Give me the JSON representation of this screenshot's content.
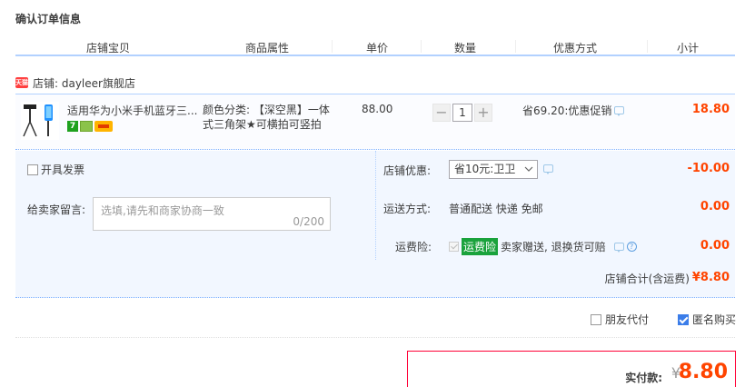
{
  "page_title": "确认订单信息",
  "columns": [
    "店铺宝贝",
    "商品属性",
    "单价",
    "数量",
    "优惠方式",
    "小计"
  ],
  "shop": {
    "badge_text": "天猫",
    "label": "店铺: dayleer旗舰店"
  },
  "item": {
    "title": "适用华为小米手机蓝牙三...",
    "badge_7": "7",
    "attributes": "颜色分类: 【深空黑】一体式三角架★可横拍可竖拍",
    "price": "88.00",
    "quantity": "1",
    "minus_label": "−",
    "plus_label": "+",
    "promo": "省69.20:优惠促销",
    "subtotal": "18.80"
  },
  "summary": {
    "invoice_label": "开具发票",
    "message_label": "给卖家留言:",
    "message_placeholder": "选填,请先和商家协商一致",
    "message_count": "0/200",
    "shop_discount_label": "店铺优惠:",
    "shop_discount_value": "省10元:卫卫",
    "shop_discount_amount": "-10.00",
    "shipping_label": "运送方式:",
    "shipping_value": "普通配送 快递 免邮",
    "shipping_amount": "0.00",
    "insurance_label": "运费险:",
    "insurance_tag": "运费险",
    "insurance_text": "卖家赠送, 退换货可赔",
    "insurance_amount": "0.00",
    "shop_total_label": "店铺合计(含运费)",
    "shop_total_amount": "¥8.80"
  },
  "options": {
    "friend_pay": "朋友代付",
    "anonymous": "匿名购买"
  },
  "payment": {
    "label": "实付款:",
    "currency": "¥",
    "amount": "8.80"
  },
  "colors": {
    "accent_red": "#ff4400",
    "header_line": "#b2d1ff",
    "summary_bg": "#f2f7ff",
    "insurance_green": "#1aa23c"
  }
}
